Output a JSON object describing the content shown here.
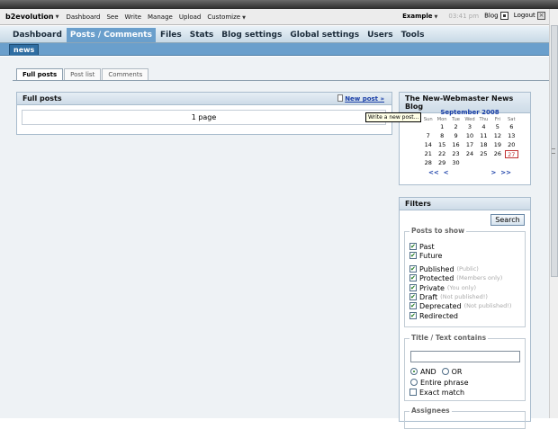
{
  "topbar": {
    "brand": "b2evolution",
    "items": [
      {
        "label": "Dashboard"
      },
      {
        "label": "See"
      },
      {
        "label": "Write"
      },
      {
        "label": "Manage"
      },
      {
        "label": "Upload"
      },
      {
        "label": "Customize"
      }
    ],
    "blog_select": "Example",
    "time": "03:41 pm",
    "blog_link": "Blog",
    "logout": "Logout"
  },
  "mainnav": {
    "items": [
      {
        "label": "Dashboard"
      },
      {
        "label": "Posts / Comments"
      },
      {
        "label": "Files"
      },
      {
        "label": "Stats"
      },
      {
        "label": "Blog settings"
      },
      {
        "label": "Global settings"
      },
      {
        "label": "Users"
      },
      {
        "label": "Tools"
      }
    ],
    "active": "Posts / Comments"
  },
  "subnav": {
    "active_blog": "news"
  },
  "tabs": [
    {
      "label": "Full posts"
    },
    {
      "label": "Post list"
    },
    {
      "label": "Comments"
    }
  ],
  "fullposts": {
    "title": "Full posts",
    "new_post": "New post »",
    "page_info": "1 page",
    "tooltip": "Write a new post..."
  },
  "blog_panel": {
    "title": "The New-Webmaster News Blog",
    "calendar": {
      "month": "September 2008",
      "days": [
        "Sun",
        "Mon",
        "Tue",
        "Wed",
        "Thu",
        "Fri",
        "Sat"
      ],
      "rows": [
        [
          "",
          "1",
          "2",
          "3",
          "4",
          "5",
          "6"
        ],
        [
          "7",
          "8",
          "9",
          "10",
          "11",
          "12",
          "13"
        ],
        [
          "14",
          "15",
          "16",
          "17",
          "18",
          "19",
          "20"
        ],
        [
          "21",
          "22",
          "23",
          "24",
          "25",
          "26",
          "27"
        ],
        [
          "28",
          "29",
          "30",
          "",
          "",
          "",
          ""
        ]
      ],
      "today": "27",
      "nav_prev_year": "<<",
      "nav_prev": "<",
      "nav_next": ">",
      "nav_next_year": ">>"
    }
  },
  "filters": {
    "title": "Filters",
    "search_button": "Search",
    "posts_to_show": {
      "legend": "Posts to show",
      "items": [
        {
          "label": "Past",
          "hint": "",
          "checked": true
        },
        {
          "label": "Future",
          "hint": "",
          "checked": true
        },
        {
          "label": "Published",
          "hint": "(Public)",
          "checked": true
        },
        {
          "label": "Protected",
          "hint": "(Members only)",
          "checked": true
        },
        {
          "label": "Private",
          "hint": "(You only)",
          "checked": true
        },
        {
          "label": "Draft",
          "hint": "(Not published!)",
          "checked": true
        },
        {
          "label": "Deprecated",
          "hint": "(Not published!)",
          "checked": true
        },
        {
          "label": "Redirected",
          "hint": "",
          "checked": true
        }
      ]
    },
    "title_text": {
      "legend": "Title / Text contains",
      "value": "",
      "and_label": "AND",
      "or_label": "OR",
      "entire_phrase": "Entire phrase",
      "exact_match": "Exact match"
    },
    "assignees": {
      "legend": "Assignees"
    }
  }
}
